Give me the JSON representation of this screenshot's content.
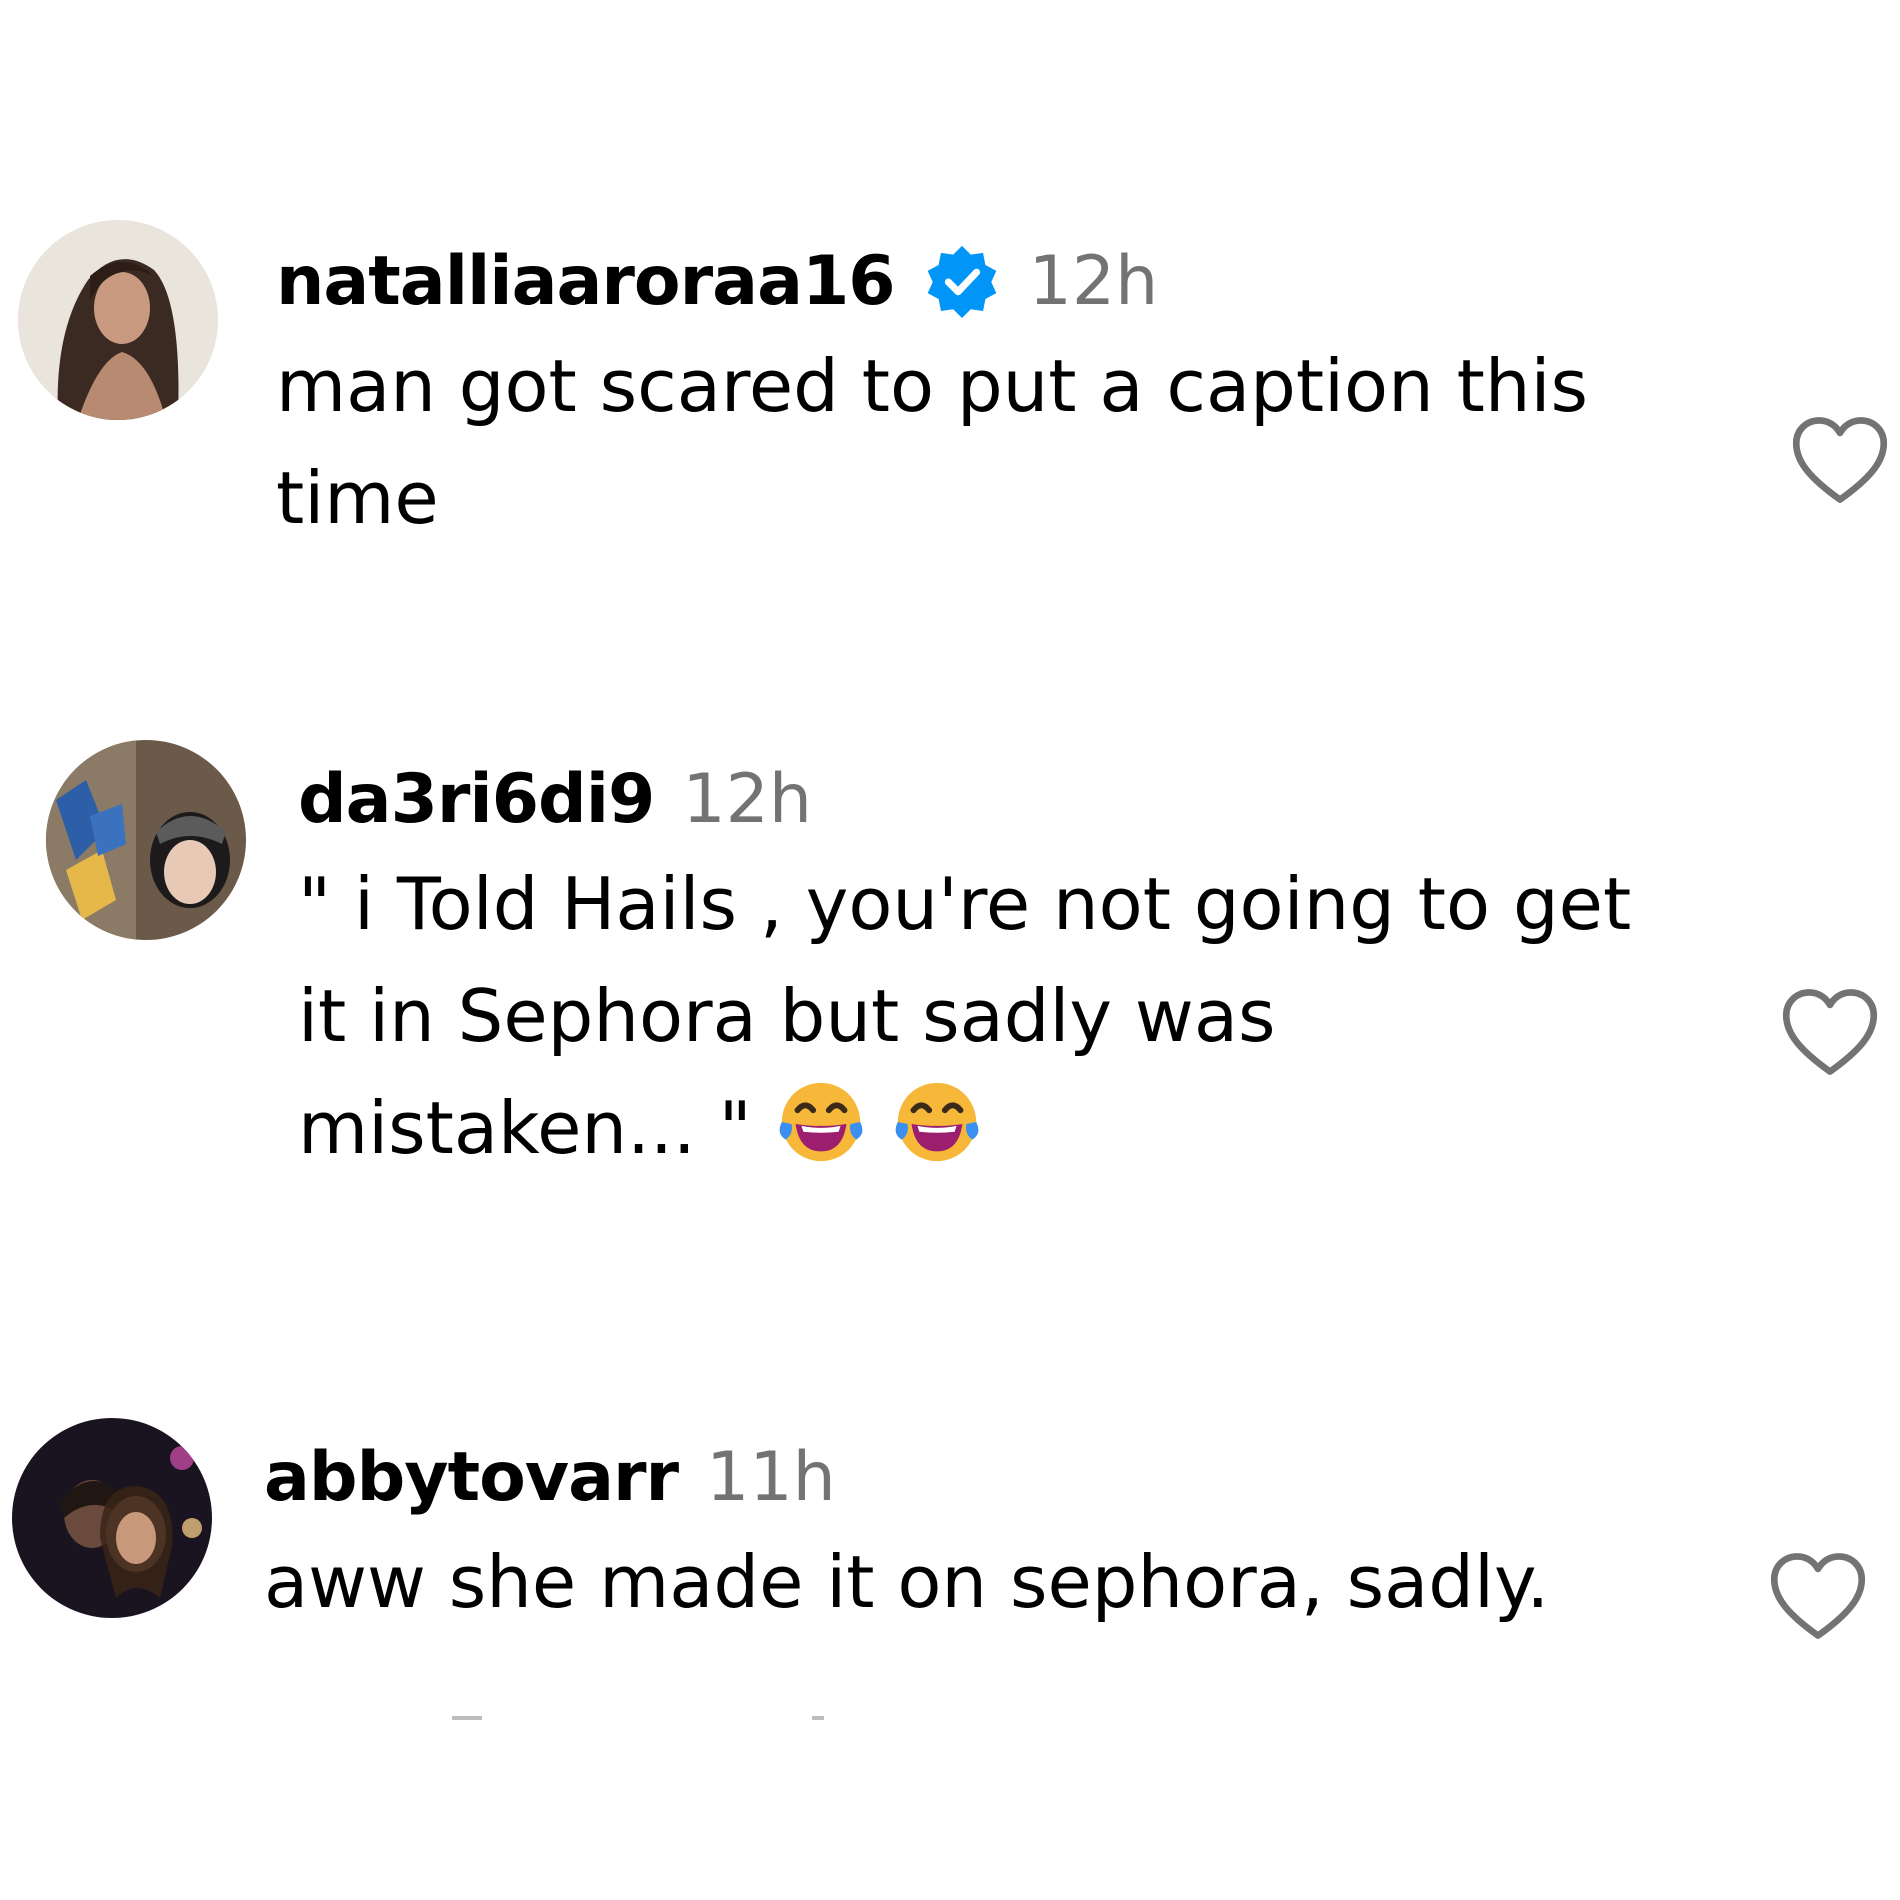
{
  "comments": [
    {
      "username": "natalliaaroraa16",
      "verified": true,
      "time": "12h",
      "text": "man got scared to put a caption this time",
      "emojis": []
    },
    {
      "username": "da3ri6di9",
      "verified": false,
      "time": "12h",
      "text": "\" i Told Hails , you're not going to get it in Sephora but sadly was mistaken... \"",
      "emojis": [
        "face-with-tears-of-joy",
        "face-with-tears-of-joy"
      ]
    },
    {
      "username": "abbytovarr",
      "verified": false,
      "time": "11h",
      "text": "aww she made it on sephora, sadly.",
      "emojis": []
    }
  ],
  "colors": {
    "text": "#000000",
    "timestamp": "#737373",
    "verified_badge": "#0095f6",
    "heart_outline": "#737373"
  },
  "icons": {
    "like": "heart-outline-icon",
    "verified": "verified-badge-icon",
    "emoji": "face-with-tears-of-joy"
  }
}
